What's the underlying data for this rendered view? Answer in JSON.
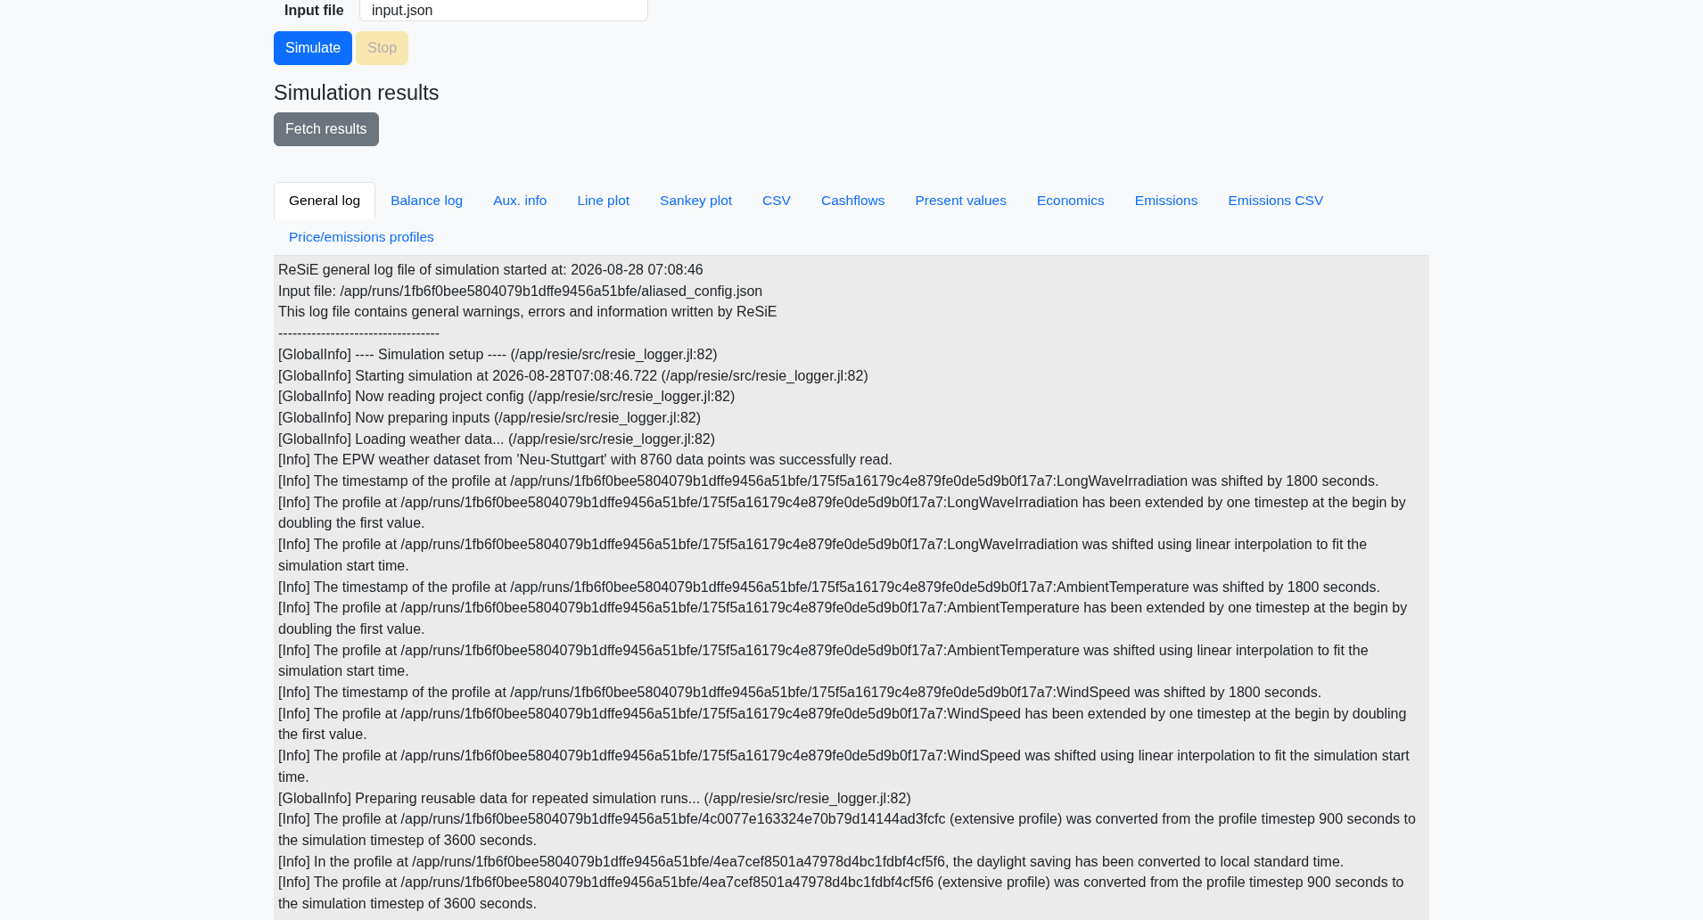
{
  "input_file": {
    "label": "Input file",
    "value": "input.json"
  },
  "actions": [
    {
      "label": "Simulate",
      "kind": "primary",
      "disabled": false
    },
    {
      "label": "Stop",
      "kind": "warning",
      "disabled": true
    }
  ],
  "results": {
    "title": "Simulation results",
    "buttons": [
      {
        "label": "Fetch results",
        "kind": "secondary",
        "disabled": false
      }
    ]
  },
  "tabs": [
    {
      "label": "General log",
      "selected": true
    },
    {
      "label": "Balance log",
      "selected": false
    },
    {
      "label": "Aux. info",
      "selected": false
    },
    {
      "label": "Line plot",
      "selected": false
    },
    {
      "label": "Sankey plot",
      "selected": false
    },
    {
      "label": "CSV",
      "selected": false
    },
    {
      "label": "Cashflows",
      "selected": false
    },
    {
      "label": "Present values",
      "selected": false
    },
    {
      "label": "Economics",
      "selected": false
    },
    {
      "label": "Emissions",
      "selected": false
    },
    {
      "label": "Emissions CSV",
      "selected": false
    },
    {
      "label": "Price/emissions profiles",
      "selected": false
    }
  ],
  "log": {
    "lines": [
      "ReSiE general log file of simulation started at: 2026-08-28 07:08:46",
      "Input file: /app/runs/1fb6f0bee5804079b1dffe9456a51bfe/aliased_config.json",
      "This log file contains general warnings, errors and information written by ReSiE",
      "----------------------------------",
      "[GlobalInfo] ---- Simulation setup ---- (/app/resie/src/resie_logger.jl:82)",
      "[GlobalInfo] Starting simulation at 2026-08-28T07:08:46.722 (/app/resie/src/resie_logger.jl:82)",
      "[GlobalInfo] Now reading project config (/app/resie/src/resie_logger.jl:82)",
      "[GlobalInfo] Now preparing inputs (/app/resie/src/resie_logger.jl:82)",
      "[GlobalInfo] Loading weather data... (/app/resie/src/resie_logger.jl:82)",
      "[Info] The EPW weather dataset from 'Neu-Stuttgart' with 8760 data points was successfully read.",
      "[Info] The timestamp of the profile at /app/runs/1fb6f0bee5804079b1dffe9456a51bfe/175f5a16179c4e879fe0de5d9b0f17a7:LongWaveIrradiation was shifted by 1800 seconds.",
      "[Info] The profile at /app/runs/1fb6f0bee5804079b1dffe9456a51bfe/175f5a16179c4e879fe0de5d9b0f17a7:LongWaveIrradiation has been extended by one timestep at the begin by doubling the first value.",
      "[Info] The profile at /app/runs/1fb6f0bee5804079b1dffe9456a51bfe/175f5a16179c4e879fe0de5d9b0f17a7:LongWaveIrradiation was shifted using linear interpolation to fit the simulation start time.",
      "[Info] The timestamp of the profile at /app/runs/1fb6f0bee5804079b1dffe9456a51bfe/175f5a16179c4e879fe0de5d9b0f17a7:AmbientTemperature was shifted by 1800 seconds.",
      "[Info] The profile at /app/runs/1fb6f0bee5804079b1dffe9456a51bfe/175f5a16179c4e879fe0de5d9b0f17a7:AmbientTemperature has been extended by one timestep at the begin by doubling the first value.",
      "[Info] The profile at /app/runs/1fb6f0bee5804079b1dffe9456a51bfe/175f5a16179c4e879fe0de5d9b0f17a7:AmbientTemperature was shifted using linear interpolation to fit the simulation start time.",
      "[Info] The timestamp of the profile at /app/runs/1fb6f0bee5804079b1dffe9456a51bfe/175f5a16179c4e879fe0de5d9b0f17a7:WindSpeed was shifted by 1800 seconds.",
      "[Info] The profile at /app/runs/1fb6f0bee5804079b1dffe9456a51bfe/175f5a16179c4e879fe0de5d9b0f17a7:WindSpeed has been extended by one timestep at the begin by doubling the first value.",
      "[Info] The profile at /app/runs/1fb6f0bee5804079b1dffe9456a51bfe/175f5a16179c4e879fe0de5d9b0f17a7:WindSpeed was shifted using linear interpolation to fit the simulation start time.",
      "[GlobalInfo] Preparing reusable data for repeated simulation runs... (/app/resie/src/resie_logger.jl:82)",
      "[Info] The profile at /app/runs/1fb6f0bee5804079b1dffe9456a51bfe/4c0077e163324e70b79d14144ad3fcfc (extensive profile) was converted from the profile timestep 900 seconds to the simulation timestep of 3600 seconds.",
      "[Info] In the profile at /app/runs/1fb6f0bee5804079b1dffe9456a51bfe/4ea7cef8501a47978d4bc1fdbf4cf5f6, the daylight saving has been converted to local standard time.",
      "[Info] The profile at /app/runs/1fb6f0bee5804079b1dffe9456a51bfe/4ea7cef8501a47978d4bc1fdbf4cf5f6 (extensive profile) was converted from the profile timestep 900 seconds to the simulation timestep of 3600 seconds."
    ]
  }
}
